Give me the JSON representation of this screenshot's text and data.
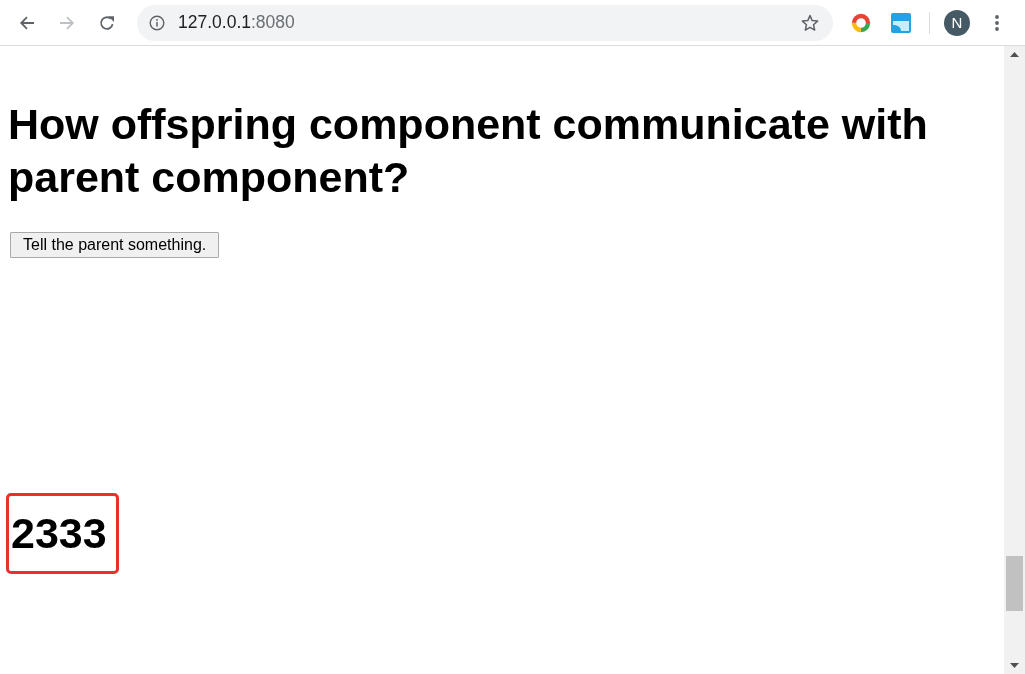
{
  "browser": {
    "nav_buttons": [
      {
        "kind": "back",
        "disabled": false
      },
      {
        "kind": "forward",
        "disabled": true
      },
      {
        "kind": "reload",
        "disabled": false
      }
    ],
    "address_bar": {
      "host": "127.0.0.1",
      "port": ":8080"
    },
    "profile": {
      "letter": "N"
    }
  },
  "page": {
    "heading": "How offspring component communicate with parent component?",
    "button": "Tell the parent something.",
    "message": {
      "text": "2333",
      "highlighted": true
    }
  }
}
